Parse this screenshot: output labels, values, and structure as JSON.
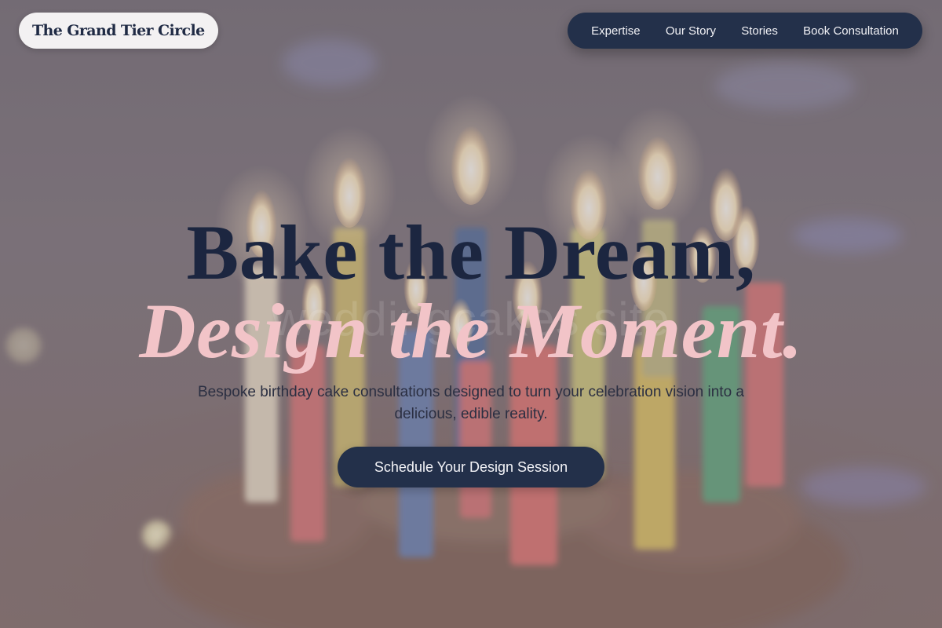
{
  "brand": {
    "name": "The Grand Tier Circle"
  },
  "nav": {
    "items": [
      {
        "label": "Expertise"
      },
      {
        "label": "Our Story"
      },
      {
        "label": "Stories"
      },
      {
        "label": "Book Consultation"
      }
    ]
  },
  "hero": {
    "headline_line1": "Bake the Dream,",
    "headline_line2": "Design the Moment.",
    "watermark": "weddingcakes.site",
    "subtitle": "Bespoke birthday cake consultations designed to turn your celebration vision into a delicious, edible reality.",
    "cta_label": "Schedule Your Design Session",
    "background_image": "birthday-cake-candles-photo"
  },
  "colors": {
    "navy": "#23304a",
    "headline_dark": "#1c2640",
    "headline_pink": "#f2c4c8",
    "brand_pill": "#f3f1f2"
  }
}
